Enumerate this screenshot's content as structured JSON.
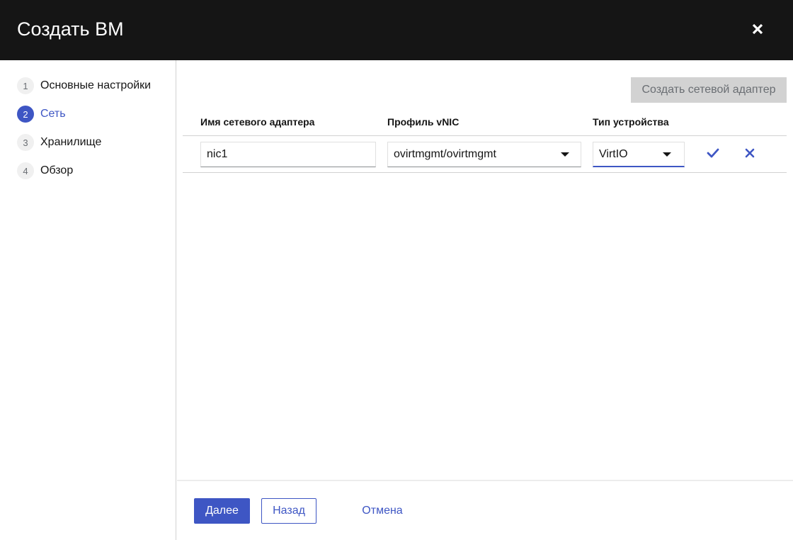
{
  "header": {
    "title": "Создать ВМ"
  },
  "steps": [
    {
      "number": "1",
      "label": "Основные настройки"
    },
    {
      "number": "2",
      "label": "Сеть"
    },
    {
      "number": "3",
      "label": "Хранилище"
    },
    {
      "number": "4",
      "label": "Обзор"
    }
  ],
  "toolbar": {
    "create_nic_label": "Создать сетевой адаптер"
  },
  "table": {
    "columns": [
      "Имя сетевого адаптера",
      "Профиль vNIC",
      "Тип устройства"
    ],
    "row": {
      "nic_name": "nic1",
      "vnic_profile": "ovirtmgmt/ovirtmgmt",
      "device_type": "VirtIO"
    }
  },
  "footer": {
    "next_label": "Далее",
    "back_label": "Назад",
    "cancel_label": "Отмена"
  },
  "colors": {
    "accent": "#3e56c4",
    "header_bg": "#151515"
  },
  "icons": [
    "close-icon",
    "check-icon",
    "cancel-x-icon",
    "caret-down-icon"
  ]
}
